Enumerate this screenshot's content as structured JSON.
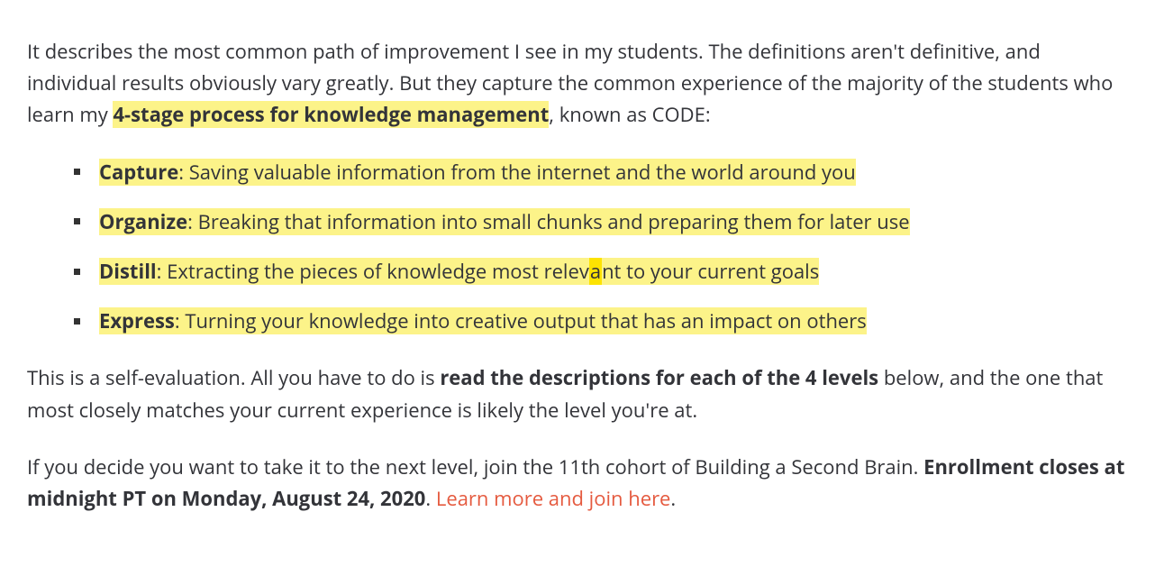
{
  "para1": {
    "pre": "It describes the most common path of improvement I see in my students. The definitions aren't definitive, and individual results obviously vary greatly. But they capture the common experience of the majority of the students who learn my ",
    "hl": "4-stage process for knowledge management",
    "post": ", known as CODE:"
  },
  "bullets": [
    {
      "term": "Capture",
      "desc": ": Saving valuable information from the internet and the world around you"
    },
    {
      "term": "Organize",
      "desc": ": Breaking that information into small chunks and preparing them for later use"
    },
    {
      "term": "Distill",
      "desc_a": ": Extracting the pieces of knowledge most relev",
      "caret": "a",
      "desc_b": "nt to your current goals"
    },
    {
      "term": "Express",
      "desc": ": Turning your knowledge into creative output that has an impact on others"
    }
  ],
  "para2": {
    "pre": "This is a self-evaluation. All you have to do is ",
    "bold": "read the descriptions for each of the 4 levels",
    "post": " below, and the one that most closely matches your current experience is likely the level you're at."
  },
  "para3": {
    "pre": "If you decide you want to take it to the next level, join the 11th cohort of Building a Second Brain. ",
    "bold": "Enrollment closes at midnight PT on Monday, August 24, 2020",
    "mid": ". ",
    "link": "Learn more and join here",
    "post": "."
  }
}
